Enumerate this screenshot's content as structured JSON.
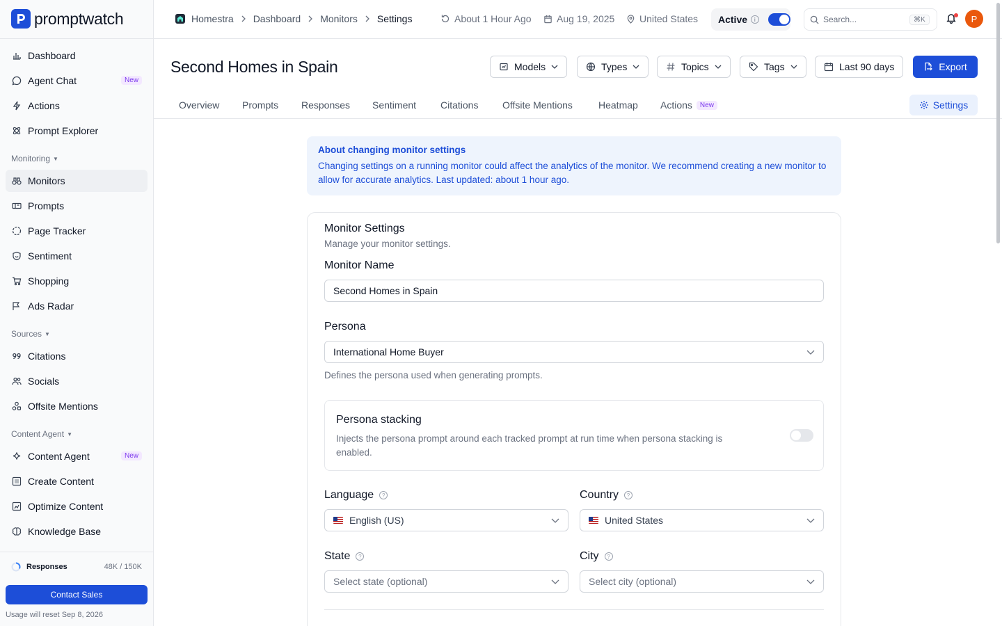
{
  "app": {
    "name": "promptwatch"
  },
  "sidebar": {
    "items_top": [
      {
        "label": "Dashboard",
        "icon": "bar-chart-icon"
      },
      {
        "label": "Agent Chat",
        "icon": "chat-icon",
        "badge": "New"
      },
      {
        "label": "Actions",
        "icon": "bolt-icon"
      },
      {
        "label": "Prompt Explorer",
        "icon": "atom-icon"
      }
    ],
    "sections": {
      "monitoring": "Monitoring",
      "sources": "Sources",
      "content_agent": "Content Agent"
    },
    "monitoring_items": [
      {
        "label": "Monitors",
        "icon": "binoculars-icon",
        "active": true
      },
      {
        "label": "Prompts",
        "icon": "prompt-icon"
      },
      {
        "label": "Page Tracker",
        "icon": "dashed-circle-icon"
      },
      {
        "label": "Sentiment",
        "icon": "shield-smile-icon"
      },
      {
        "label": "Shopping",
        "icon": "cart-icon"
      },
      {
        "label": "Ads Radar",
        "icon": "flag-icon"
      }
    ],
    "sources_items": [
      {
        "label": "Citations",
        "icon": "quote-icon"
      },
      {
        "label": "Socials",
        "icon": "users-icon"
      },
      {
        "label": "Offsite Mentions",
        "icon": "shapes-icon"
      }
    ],
    "content_items": [
      {
        "label": "Content Agent",
        "icon": "sparkle-icon",
        "badge": "New"
      },
      {
        "label": "Create Content",
        "icon": "document-icon"
      },
      {
        "label": "Optimize Content",
        "icon": "chart-doc-icon"
      },
      {
        "label": "Knowledge Base",
        "icon": "brain-icon"
      }
    ],
    "usage": {
      "label": "Responses",
      "value": "48K / 150K",
      "fraction": 0.32
    },
    "contact_button": "Contact Sales",
    "reset_note": "Usage will reset Sep 8, 2026"
  },
  "topbar": {
    "breadcrumbs": [
      "Homestra",
      "Dashboard",
      "Monitors",
      "Settings"
    ],
    "updated": "About 1 Hour Ago",
    "date": "Aug 19, 2025",
    "location": "United States",
    "status_label": "Active",
    "status_on": true,
    "search_placeholder": "Search...",
    "search_shortcut": "⌘K",
    "avatar_initial": "P"
  },
  "header": {
    "title": "Second Homes in Spain",
    "filters": [
      "Models",
      "Types",
      "Topics",
      "Tags"
    ],
    "date_range": "Last 90 days",
    "export_label": "Export"
  },
  "tabs": {
    "items": [
      "Overview",
      "Prompts",
      "Responses",
      "Sentiment",
      "Citations",
      "Offsite Mentions",
      "Heatmap",
      "Actions"
    ],
    "actions_badge": "New",
    "settings": "Settings"
  },
  "notice": {
    "title": "About changing monitor settings",
    "body": "Changing settings on a running monitor could affect the analytics of the monitor. We recommend creating a new monitor to allow for accurate analytics. Last updated: about 1 hour ago."
  },
  "settings_card": {
    "title": "Monitor Settings",
    "subtitle": "Manage your monitor settings.",
    "monitor_name_label": "Monitor Name",
    "monitor_name_value": "Second Homes in Spain",
    "persona_label": "Persona",
    "persona_value": "International Home Buyer",
    "persona_help": "Defines the persona used when generating prompts.",
    "stacking_title": "Persona stacking",
    "stacking_desc": "Injects the persona prompt around each tracked prompt at run time when persona stacking is enabled.",
    "stacking_on": false,
    "language_label": "Language",
    "language_value": "English (US)",
    "country_label": "Country",
    "country_value": "United States",
    "state_label": "State",
    "state_placeholder": "Select state (optional)",
    "city_label": "City",
    "city_placeholder": "Select city (optional)"
  },
  "colors": {
    "accent": "#1d4ed8",
    "badge_text": "#7c3aed",
    "badge_bg": "#f3e8ff",
    "notice_bg": "#eef4fd",
    "avatar": "#ea580c"
  }
}
